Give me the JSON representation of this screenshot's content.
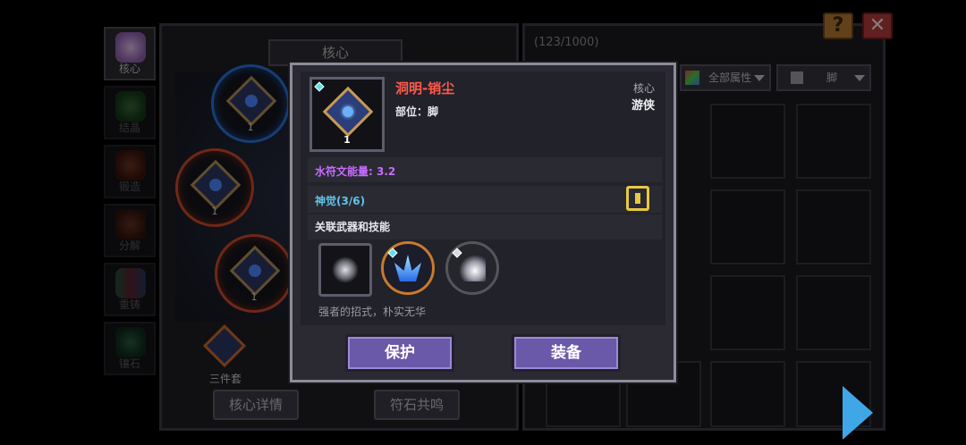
{
  "sidebar": {
    "items": [
      {
        "label": "核心",
        "icon": "core-icon",
        "color": "#b58ac8"
      },
      {
        "label": "结晶",
        "icon": "crystal-icon",
        "color": "#3cae4a"
      },
      {
        "label": "锻造",
        "icon": "forge-icon",
        "color": "#c8492b"
      },
      {
        "label": "分解",
        "icon": "decompose-icon",
        "color": "#b0452b"
      },
      {
        "label": "重铸",
        "icon": "recast-icon",
        "color": "#48a878"
      },
      {
        "label": "镶石",
        "icon": "inlay-icon",
        "color": "#3b9a6a"
      }
    ]
  },
  "core_panel": {
    "title": "核心",
    "slots": [
      {
        "level": "1",
        "frame": "blue"
      },
      {
        "level": "1",
        "frame": "red"
      },
      {
        "level": "1",
        "frame": "red"
      }
    ],
    "set_label": "三件套",
    "detail_button": "核心详情",
    "resonance_button": "符石共鸣"
  },
  "inventory": {
    "count": "(123/1000)",
    "filter_attr": "全部属性",
    "filter_part": "脚"
  },
  "modal": {
    "item": {
      "name": "洞明-销尘",
      "part": "部位：脚",
      "type": "核心",
      "class": "游侠",
      "level": "1",
      "name_color": "#ff5a4e"
    },
    "energy": "水符文能量: 3.2",
    "awaken": "神觉(3/6)",
    "linked_title": "关联武器和技能",
    "description": "强者的招式，朴实无华",
    "protect_button": "保护",
    "equip_button": "装备"
  },
  "colors": {
    "energy": "#c86cff",
    "awaken": "#5fc6e8",
    "button": "#6a58a8"
  }
}
